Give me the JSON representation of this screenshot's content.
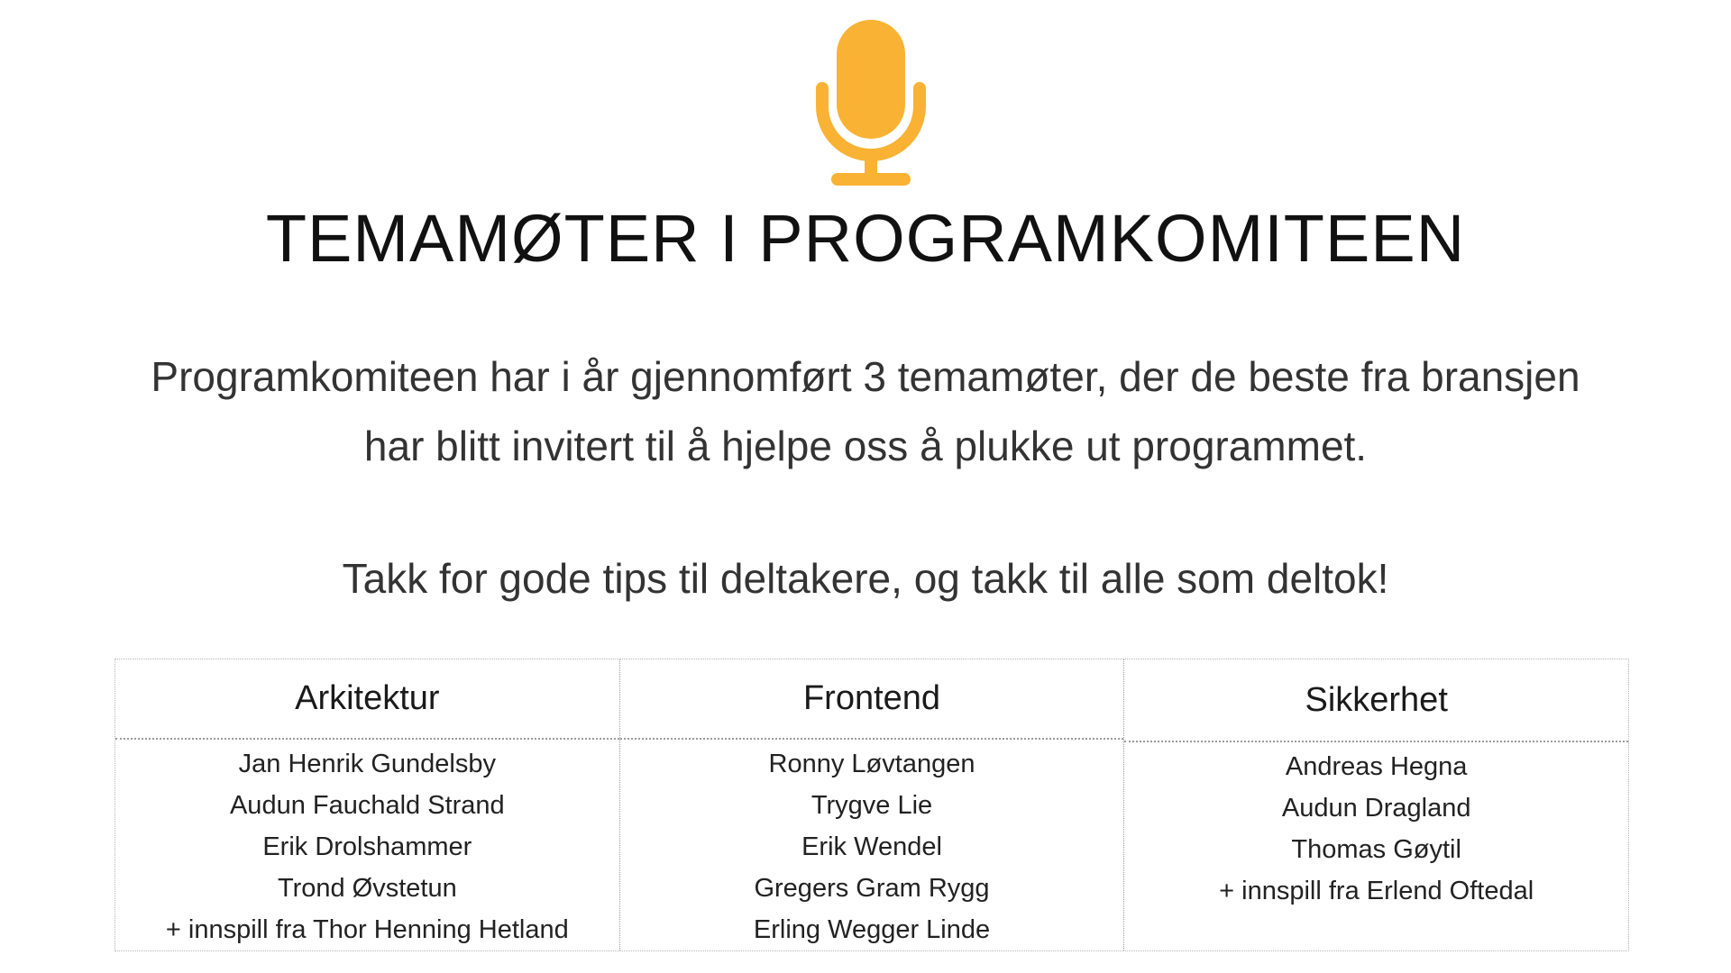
{
  "header": {
    "icon": "microphone-icon",
    "icon_color": "#F9B233",
    "title": "TEMAMØTER I PROGRAMKOMITEEN"
  },
  "intro": {
    "line1": "Programkomiteen har i år gjennomført 3 temamøter, der de beste fra bransjen",
    "line2": "har blitt invitert til å hjelpe oss å plukke ut programmet.",
    "thanks": "Takk for gode tips til deltakere, og takk til alle som deltok!"
  },
  "committees": [
    {
      "heading": "Arkitektur",
      "members": [
        "Jan Henrik Gundelsby",
        "Audun Fauchald Strand",
        "Erik Drolshammer",
        "Trond Øvstetun",
        "+ innspill fra Thor Henning Hetland"
      ]
    },
    {
      "heading": "Frontend",
      "members": [
        "Ronny Løvtangen",
        "Trygve Lie",
        "Erik Wendel",
        "Gregers Gram Rygg",
        "Erling Wegger Linde"
      ]
    },
    {
      "heading": "Sikkerhet",
      "members": [
        "Andreas Hegna",
        "Audun Dragland",
        "Thomas Gøytil",
        "+ innspill fra Erlend Oftedal"
      ]
    }
  ]
}
